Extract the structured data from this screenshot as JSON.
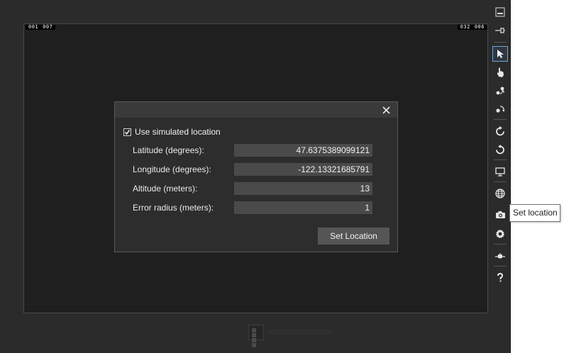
{
  "screen": {
    "fps_left": [
      "001",
      "007"
    ],
    "fps_right": [
      "032",
      "006"
    ]
  },
  "toolbar": {
    "buttons": [
      {
        "icon": "minimize-icon"
      },
      {
        "icon": "pin-icon"
      },
      {
        "icon": "mouse-pointer-icon",
        "active": true
      },
      {
        "icon": "touch-hand-icon"
      },
      {
        "icon": "pinch-zoom-icon"
      },
      {
        "icon": "rotate-touch-icon"
      },
      {
        "icon": "rotate-clockwise-icon"
      },
      {
        "icon": "rotate-counterclockwise-icon"
      },
      {
        "icon": "resolution-monitor-icon"
      },
      {
        "icon": "globe-icon",
        "hovered": true
      },
      {
        "icon": "camera-icon"
      },
      {
        "icon": "gear-icon"
      },
      {
        "icon": "network-icon"
      },
      {
        "icon": "help-icon"
      }
    ],
    "tooltip": "Set location"
  },
  "dialog": {
    "checkbox_label": "Use simulated location",
    "checkbox_checked": true,
    "rows": [
      {
        "label": "Latitude (degrees):",
        "value": "47.6375389099121"
      },
      {
        "label": "Longitude (degrees):",
        "value": "-122.13321685791"
      },
      {
        "label": "Altitude (meters):",
        "value": "13"
      },
      {
        "label": "Error radius (meters):",
        "value": "1"
      }
    ],
    "set_button": "Set Location"
  }
}
